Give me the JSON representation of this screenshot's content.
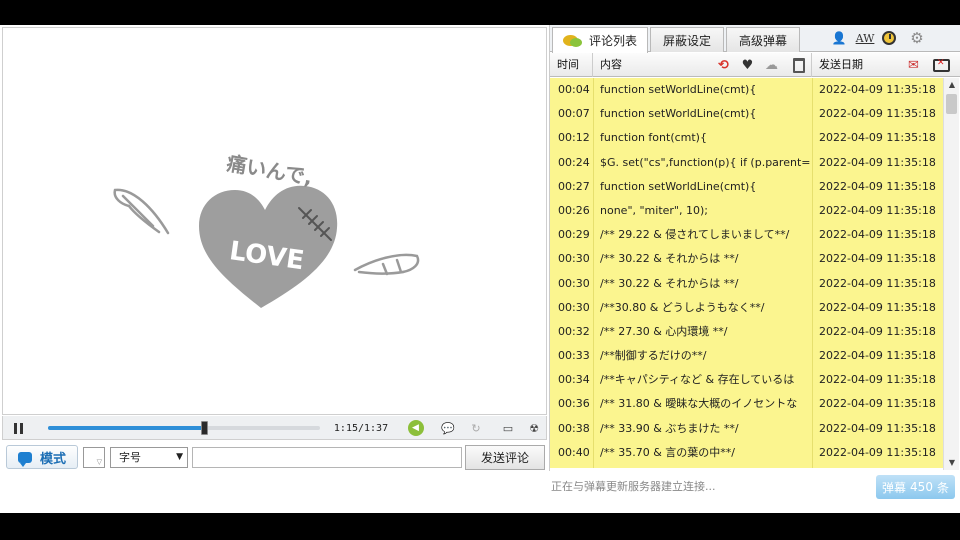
{
  "video": {
    "art_text": "痛いんで,",
    "heart_label": "LOVE"
  },
  "controls": {
    "progress_fraction": 0.575,
    "time_readout": "1:15/1:37"
  },
  "input_bar": {
    "mode_label": "模式",
    "font_size_label": "字号",
    "comment_value": "",
    "send_label": "发送评论"
  },
  "panel": {
    "tabs": [
      "评论列表",
      "屏蔽设定",
      "高级弹幕"
    ],
    "aw_label": "AW",
    "headers": {
      "time": "时间",
      "content": "内容",
      "date": "发送日期"
    },
    "rows": [
      {
        "time": "00:04",
        "content": "function setWorldLine(cmt){",
        "date": "2022-04-09 11:35:18"
      },
      {
        "time": "00:07",
        "content": "function setWorldLine(cmt){",
        "date": "2022-04-09 11:35:18"
      },
      {
        "time": "00:12",
        "content": "function font(cmt){",
        "date": "2022-04-09 11:35:18"
      },
      {
        "time": "00:24",
        "content": "$G. set(\"cs\",function(p){ if (p.parent=",
        "date": "2022-04-09 11:35:18"
      },
      {
        "time": "00:27",
        "content": "function setWorldLine(cmt){",
        "date": "2022-04-09 11:35:18"
      },
      {
        "time": "00:26",
        "content": "none\", \"miter\", 10);",
        "date": "2022-04-09 11:35:18"
      },
      {
        "time": "00:29",
        "content": "/** 29.22 & 侵されてしまいまして**/",
        "date": "2022-04-09 11:35:18"
      },
      {
        "time": "00:30",
        "content": "/** 30.22 & それからは **/",
        "date": "2022-04-09 11:35:18"
      },
      {
        "time": "00:30",
        "content": "/** 30.22 & それからは **/",
        "date": "2022-04-09 11:35:18"
      },
      {
        "time": "00:30",
        "content": "/**30.80 & どうしようもなく**/",
        "date": "2022-04-09 11:35:18"
      },
      {
        "time": "00:32",
        "content": "/** 27.30 & 心内環境 **/",
        "date": "2022-04-09 11:35:18"
      },
      {
        "time": "00:33",
        "content": "/**制御するだけの**/",
        "date": "2022-04-09 11:35:18"
      },
      {
        "time": "00:34",
        "content": "/**キャパシティなど & 存在しているは",
        "date": "2022-04-09 11:35:18"
      },
      {
        "time": "00:36",
        "content": "/** 31.80 & 曖昧な大概のイノセントな",
        "date": "2022-04-09 11:35:18"
      },
      {
        "time": "00:38",
        "content": "/** 33.90 & ぶちまけた **/",
        "date": "2022-04-09 11:35:18"
      },
      {
        "time": "00:40",
        "content": "/** 35.70 & 言の葉の中**/",
        "date": "2022-04-09 11:35:18"
      }
    ]
  },
  "status": {
    "connecting_text": "正在与弹幕更新服务器建立连接...",
    "danmaku_label": "弹幕",
    "danmaku_count": "450",
    "danmaku_unit": "条"
  },
  "colors": {
    "list_background": "#fbf58f",
    "progress_fill": "#2e8fd8",
    "badge": "#8cc8ee"
  }
}
